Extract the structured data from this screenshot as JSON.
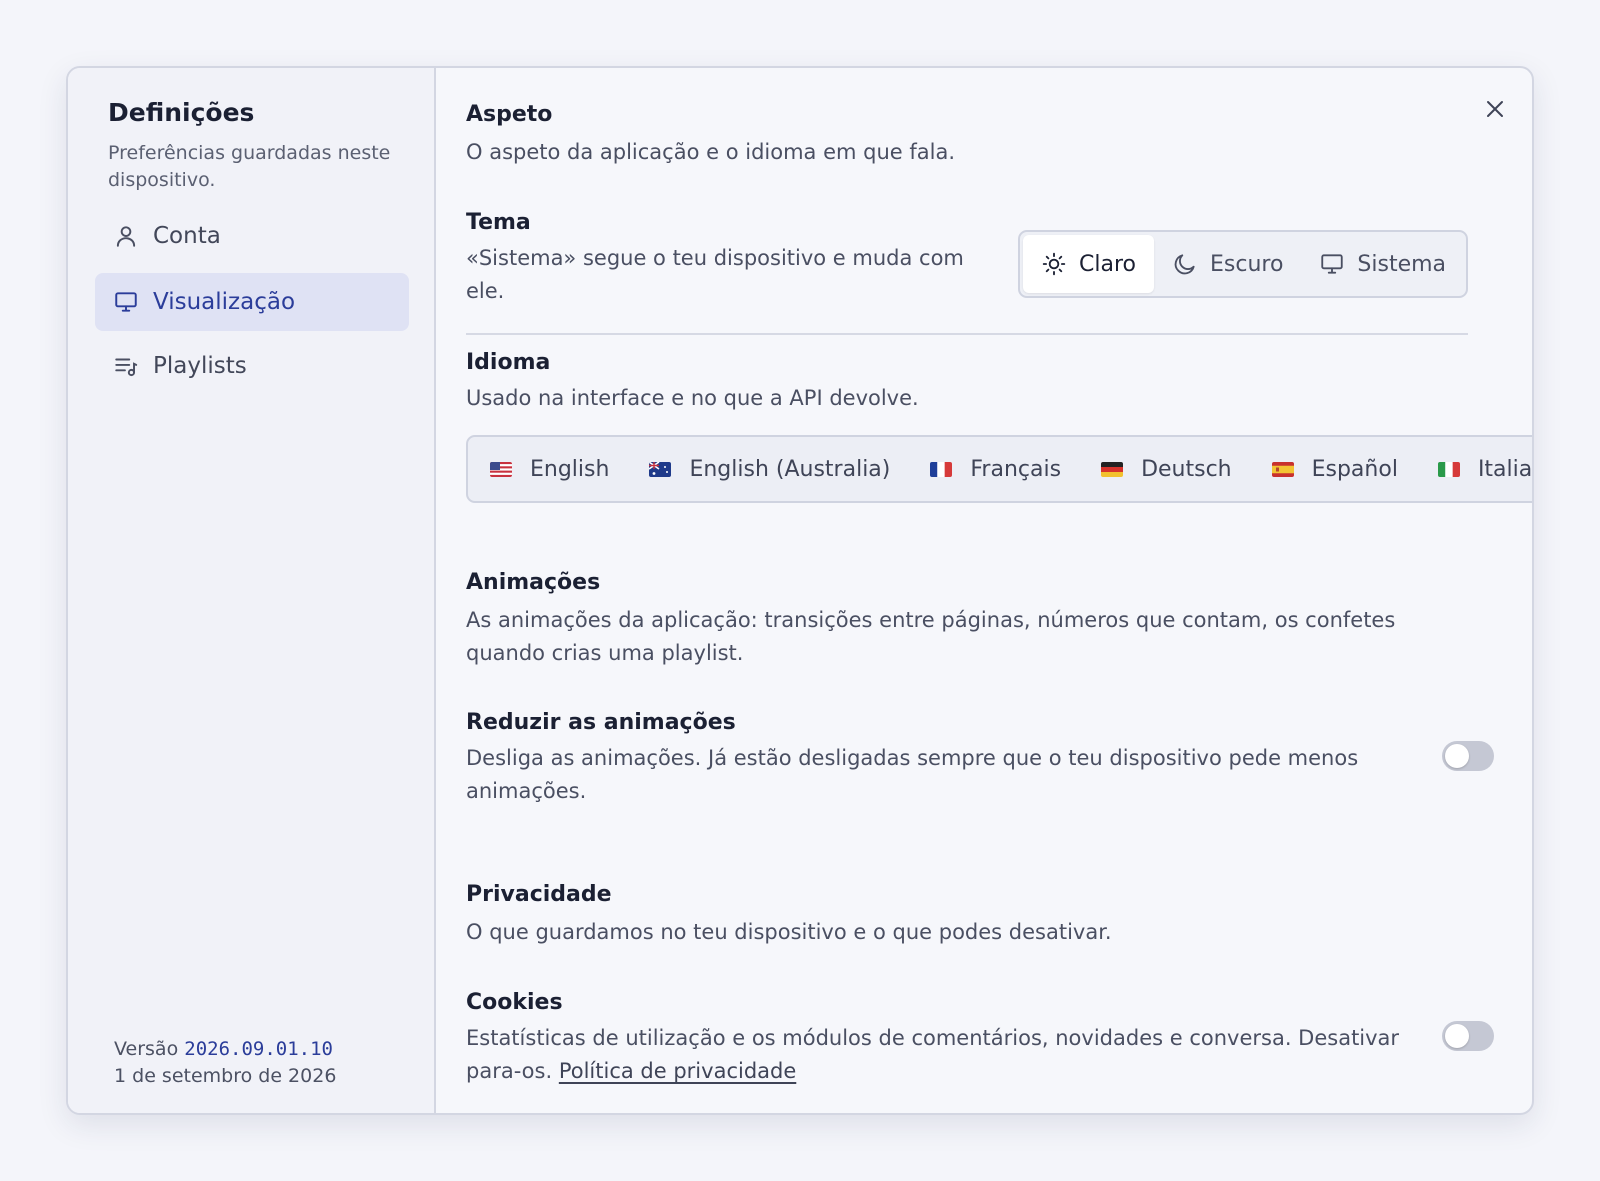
{
  "sidebar": {
    "title": "Definições",
    "subtitle": "Preferências guardadas neste dispositivo.",
    "items": [
      {
        "label": "Conta",
        "icon": "user-icon",
        "active": false
      },
      {
        "label": "Visualização",
        "icon": "monitor-icon",
        "active": true
      },
      {
        "label": "Playlists",
        "icon": "playlist-icon",
        "active": false
      }
    ],
    "version_label": "Versão",
    "version": "2026.09.01.10",
    "date": "1 de setembro de 2026"
  },
  "main": {
    "appearance": {
      "title": "Aspeto",
      "description": "O aspeto da aplicação e o idioma em que fala."
    },
    "theme": {
      "title": "Tema",
      "description": "«Sistema» segue o teu dispositivo e muda com ele.",
      "options": [
        {
          "label": "Claro",
          "icon": "sun-icon",
          "selected": true
        },
        {
          "label": "Escuro",
          "icon": "moon-icon",
          "selected": false
        },
        {
          "label": "Sistema",
          "icon": "monitor-icon",
          "selected": false
        }
      ]
    },
    "language": {
      "title": "Idioma",
      "description": "Usado na interface e no que a API devolve.",
      "options": [
        {
          "label": "English",
          "flag": "us-flag"
        },
        {
          "label": "English (Australia)",
          "flag": "au-flag"
        },
        {
          "label": "Français",
          "flag": "fr-flag"
        },
        {
          "label": "Deutsch",
          "flag": "de-flag"
        },
        {
          "label": "Español",
          "flag": "es-flag"
        },
        {
          "label": "Italiano",
          "flag": "it-flag"
        }
      ]
    },
    "animations": {
      "title": "Animações",
      "description": "As animações da aplicação: transições entre páginas, números que contam, os confetes quando crias uma playlist.",
      "reduce_title": "Reduzir as animações",
      "reduce_description": "Desliga as animações. Já estão desligadas sempre que o teu dispositivo pede menos animações.",
      "reduce_enabled": false
    },
    "privacy": {
      "title": "Privacidade",
      "description": "O que guardamos no teu dispositivo e o que podes desativar.",
      "cookies_title": "Cookies",
      "cookies_description": "Estatísticas de utilização e os módulos de comentários, novidades e conversa. Desativar para-os.",
      "privacy_link": "Política de privacidade",
      "cookies_enabled": false
    }
  },
  "colors": {
    "accent": "#2b3d9a",
    "active_bg": "#dfe2f4",
    "toggle_off": "#c5c8d4"
  }
}
